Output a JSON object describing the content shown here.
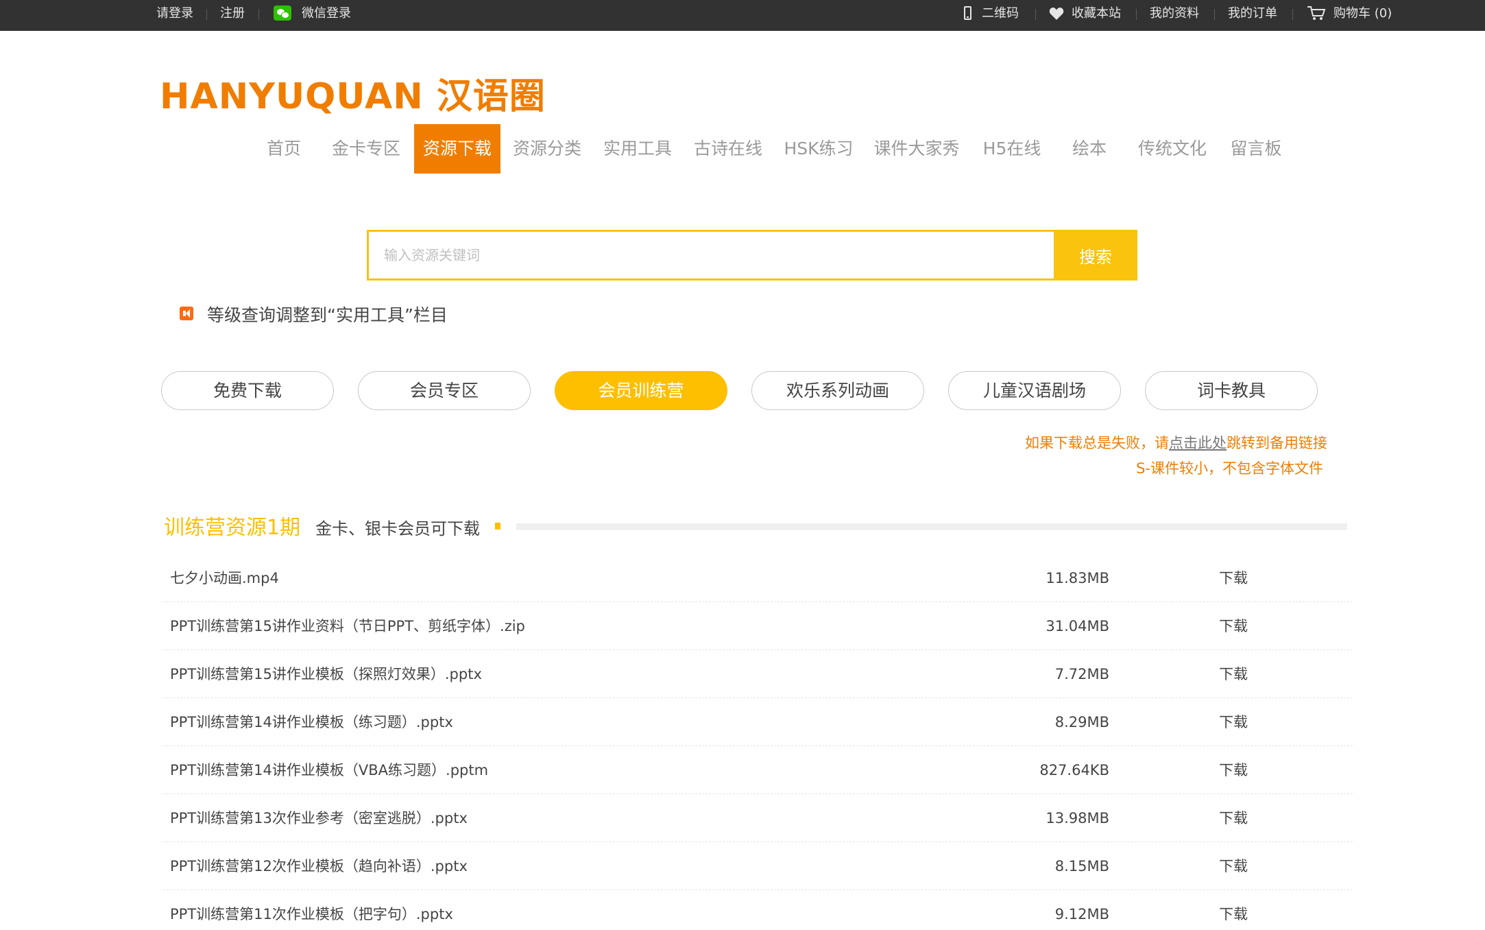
{
  "topbar": {
    "login": "请登录",
    "register": "注册",
    "wechat_login": "微信登录",
    "qrcode": "二维码",
    "favorite": "收藏本站",
    "profile": "我的资料",
    "orders": "我的订单",
    "cart": "购物车 (0)"
  },
  "logo": "HANYUQUAN 汉语圈",
  "nav": [
    "首页",
    "金卡专区",
    "资源下载",
    "资源分类",
    "实用工具",
    "古诗在线",
    "HSK练习",
    "课件大家秀",
    "H5在线",
    "绘本",
    "传统文化",
    "留言板"
  ],
  "nav_active": "资源下载",
  "search": {
    "placeholder": "输入资源关键词",
    "button": "搜索"
  },
  "notice": "等级查询调整到“实用工具”栏目",
  "categories": [
    "免费下载",
    "会员专区",
    "会员训练营",
    "欢乐系列动画",
    "儿童汉语剧场",
    "词卡教具"
  ],
  "category_active": "会员训练营",
  "info": {
    "line1_prefix": "如果下载总是失败，请",
    "line1_link": "点击此处",
    "line1_suffix": "跳转到备用链接",
    "line2": "S-课件较小，不包含字体文件"
  },
  "section": {
    "title": "训练营资源1期",
    "subtitle": "金卡、银卡会员可下载"
  },
  "files": [
    {
      "name": "七夕小动画.mp4",
      "size": "11.83MB",
      "action": "下载"
    },
    {
      "name": "PPT训练营第15讲作业资料（节日PPT、剪纸字体）.zip",
      "size": "31.04MB",
      "action": "下载"
    },
    {
      "name": "PPT训练营第15讲作业模板（探照灯效果）.pptx",
      "size": "7.72MB",
      "action": "下载"
    },
    {
      "name": "PPT训练营第14讲作业模板（练习题）.pptx",
      "size": "8.29MB",
      "action": "下载"
    },
    {
      "name": "PPT训练营第14讲作业模板（VBA练习题）.pptm",
      "size": "827.64KB",
      "action": "下载"
    },
    {
      "name": "PPT训练营第13次作业参考（密室逃脱）.pptx",
      "size": "13.98MB",
      "action": "下载"
    },
    {
      "name": "PPT训练营第12次作业模板（趋向补语）.pptx",
      "size": "8.15MB",
      "action": "下载"
    },
    {
      "name": "PPT训练营第11次作业模板（把字句）.pptx",
      "size": "9.12MB",
      "action": "下载"
    }
  ],
  "colors": {
    "brand_orange": "#f07d00",
    "accent_yellow": "#fdbf00",
    "topbar_bg": "#323232"
  }
}
